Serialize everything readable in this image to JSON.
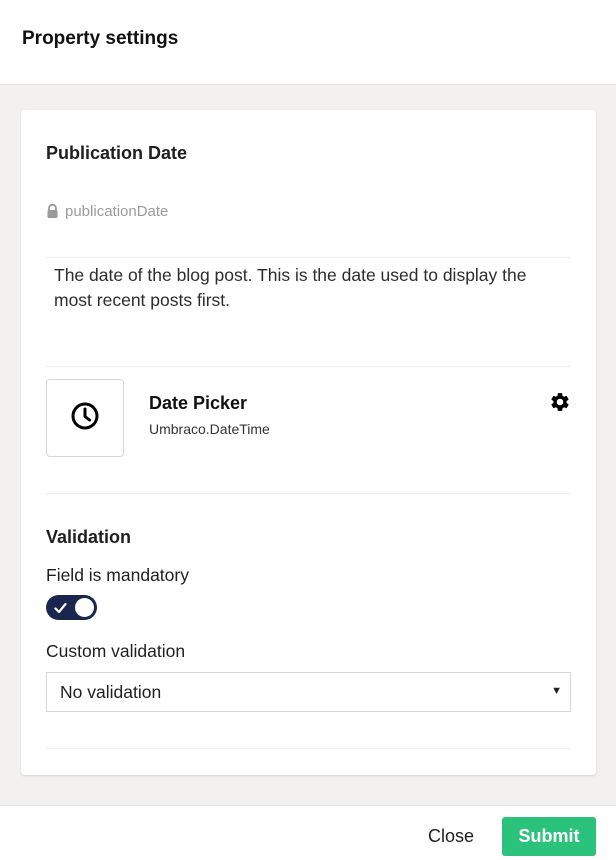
{
  "dialog": {
    "title": "Property settings"
  },
  "property": {
    "name": "Publication Date",
    "alias": "publicationDate",
    "alias_icon": "lock-icon",
    "description": "The date of the blog post. This is the date used to display the most recent posts first."
  },
  "editor": {
    "icon": "clock-icon",
    "name": "Date Picker",
    "alias": "Umbraco.DateTime",
    "settings_icon": "gear-icon"
  },
  "validation": {
    "heading": "Validation",
    "mandatory_label": "Field is mandatory",
    "mandatory_value": true,
    "custom_label": "Custom validation",
    "custom_selected": "No validation"
  },
  "footer": {
    "close_label": "Close",
    "submit_label": "Submit"
  },
  "colors": {
    "primary": "#1b264f",
    "success": "#2bc37c",
    "background": "#f3f1f0"
  }
}
